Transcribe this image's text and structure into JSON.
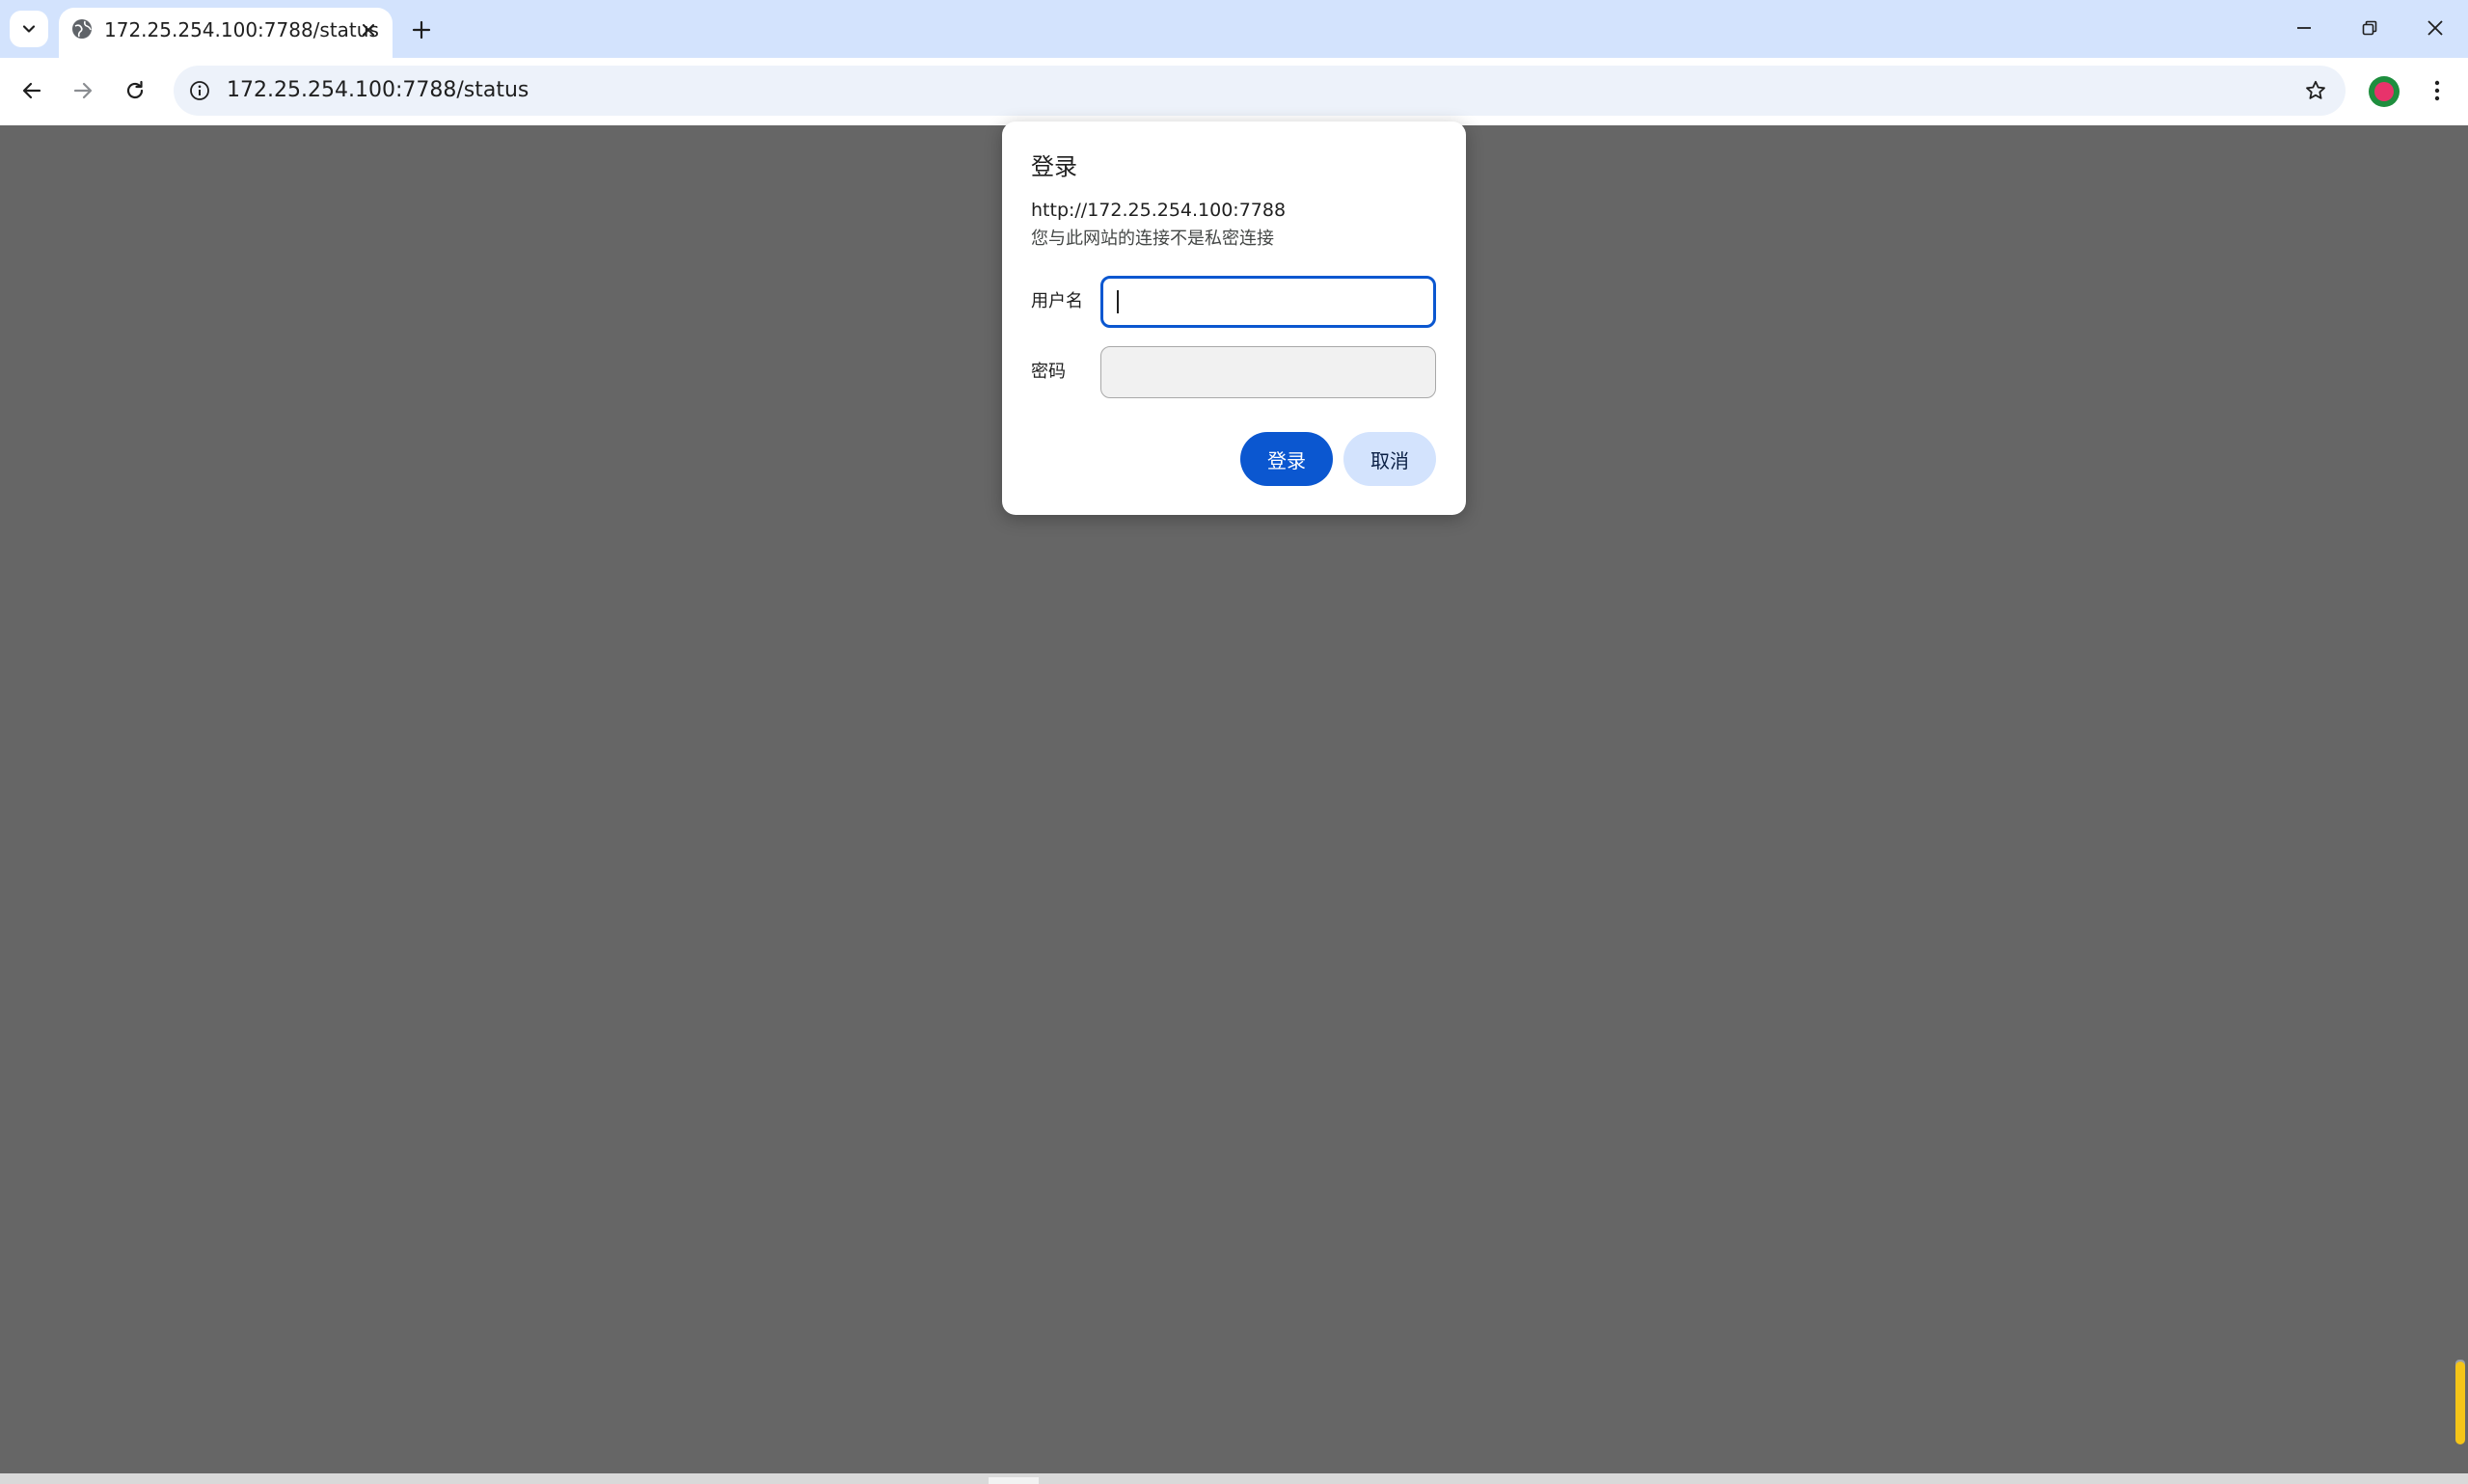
{
  "browser": {
    "tab": {
      "title": "172.25.254.100:7788/status"
    },
    "omnibox": {
      "url": "172.25.254.100:7788/status"
    },
    "icons": {
      "tab_search": "chevron-down-icon",
      "favicon": "globe-icon",
      "tab_close": "close-icon",
      "new_tab": "plus-icon",
      "minimize": "minimize-icon",
      "restore": "restore-icon",
      "close_window": "close-icon",
      "back": "back-arrow-icon",
      "forward": "forward-arrow-icon",
      "reload": "reload-icon",
      "site_info": "info-icon",
      "bookmark": "star-icon",
      "extension": "extension-icon",
      "menu": "kebab-menu-icon"
    }
  },
  "dialog": {
    "title": "登录",
    "origin": "http://172.25.254.100:7788",
    "warning": "您与此网站的连接不是私密连接",
    "username_label": "用户名",
    "username_value": "",
    "password_label": "密码",
    "password_value": "",
    "login_button": "登录",
    "cancel_button": "取消"
  },
  "colors": {
    "accent": "#0b57d0",
    "tabstrip": "#d3e3fd",
    "page_overlay": "#666666",
    "cancel_button_bg": "#d3e3fd"
  }
}
